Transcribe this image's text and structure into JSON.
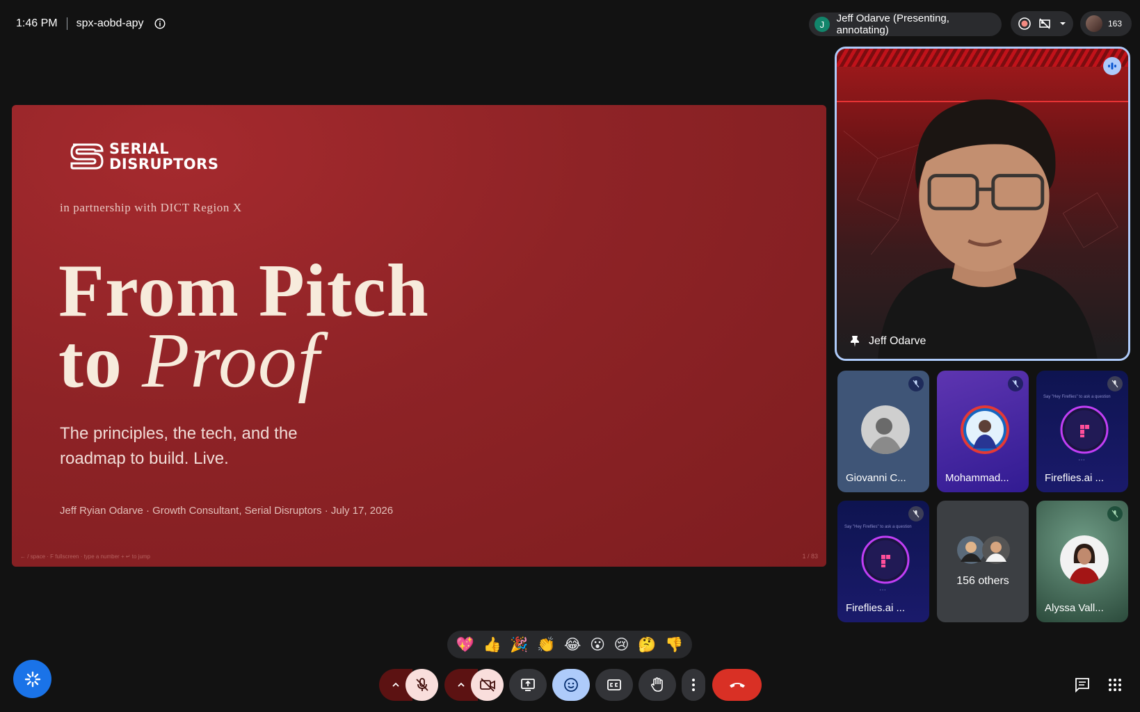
{
  "meeting": {
    "time": "1:46 PM",
    "code": "spx-aobd-apy"
  },
  "presenter_chip": {
    "initial": "J",
    "label": "Jeff Odarve (Presenting, annotating)"
  },
  "people_count": "163",
  "slide": {
    "logo_line1": "SERIAL",
    "logo_line2": "DISRUPTORS",
    "partner": "in partnership with DICT Region X",
    "title_line1": "From Pitch",
    "title_line2_plain": "to ",
    "title_line2_italic": "Proof",
    "subtitle_line1": "The principles, the tech, and the",
    "subtitle_line2": "roadmap to build. Live.",
    "byline": "Jeff Ryian Odarve · Growth Consultant, Serial Disruptors · July 17, 2026",
    "hint": "← / space · F fullscreen · type a number + ↵ to jump",
    "page": "1 / 83"
  },
  "speaker": {
    "name": "Jeff Odarve"
  },
  "participants": [
    {
      "name": "Giovanni C...",
      "bg": "#3f5577"
    },
    {
      "name": "Mohammad...",
      "bg": "#4527a0"
    },
    {
      "name": "Fireflies.ai ...",
      "bg": "#13175a",
      "caption": "Say \"Hey Fireflies\" to ask a question"
    },
    {
      "name": "Fireflies.ai ...",
      "bg": "#13175a",
      "caption": "Say \"Hey Fireflies\" to ask a question"
    },
    {
      "name": "156 others",
      "bg": "#3c3f43"
    },
    {
      "name": "Alyssa Vall...",
      "bg": "#2e4a3c"
    }
  ],
  "reactions": [
    "💖",
    "👍",
    "🎉",
    "👏",
    "😂",
    "😮",
    "😢",
    "🤔",
    "👎"
  ],
  "colors": {
    "slide_red": "#8e2326",
    "speaking_border": "#aecbfa",
    "end_call": "#d93025",
    "muted_control": "#f9dedc",
    "active_reaction": "#aecbfa"
  }
}
